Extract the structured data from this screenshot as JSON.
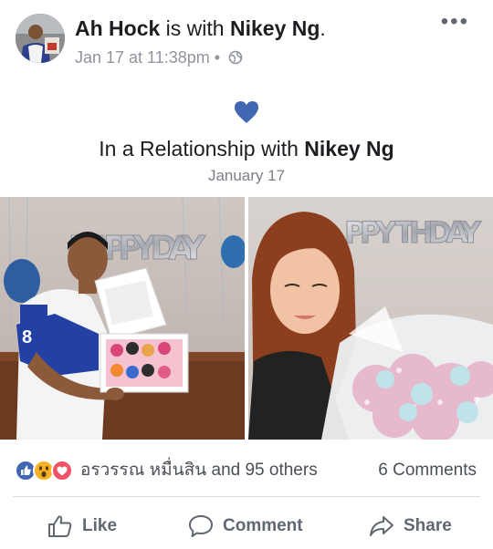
{
  "header": {
    "author": "Ah Hock",
    "with_text": " is with ",
    "tagged": "Nikey Ng",
    "period": ".",
    "timestamp": "Jan 17 at 11:38pm",
    "separator": " • ",
    "privacy_icon": "globe-icon",
    "more_label": "•••"
  },
  "life_event": {
    "icon": "heart-icon",
    "title_prefix": "In a Relationship with ",
    "partner": "Nikey Ng",
    "date": "January 17"
  },
  "photos": {
    "left_balloon_text": "HAPPY DAY",
    "right_balloon_text": "PPY THDAY",
    "shirt_number": "8"
  },
  "reactions": {
    "icons": [
      "like-reaction-icon",
      "wow-reaction-icon",
      "love-reaction-icon"
    ],
    "names": "อรวรรณ หมื่นสิน and 95 others",
    "comments": "6 Comments"
  },
  "actions": {
    "like": "Like",
    "comment": "Comment",
    "share": "Share"
  },
  "colors": {
    "brand_blue": "#4267b2",
    "love_red": "#f25268",
    "wow_yellow": "#f7b125",
    "meta_gray": "#90949c",
    "action_gray": "#606770"
  }
}
